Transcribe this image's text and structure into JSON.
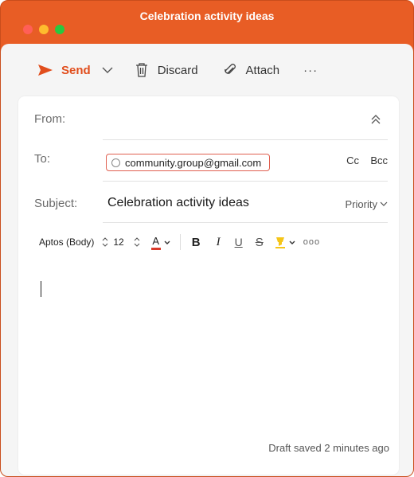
{
  "window": {
    "title": "Celebration activity ideas",
    "accent_color": "#e85d25"
  },
  "toolbar": {
    "send_label": "Send",
    "discard_label": "Discard",
    "attach_label": "Attach",
    "more_label": "···"
  },
  "fields": {
    "from_label": "From:",
    "to_label": "To:",
    "recipient": "community.group@gmail.com",
    "cc_label": "Cc",
    "bcc_label": "Bcc",
    "subject_label": "Subject:",
    "subject_value": "Celebration activity ideas",
    "priority_label": "Priority"
  },
  "formatting": {
    "font_name": "Aptos (Body)",
    "font_size": "12",
    "font_color_glyph": "A",
    "bold_glyph": "B",
    "italic_glyph": "I",
    "underline_glyph": "U",
    "strike_glyph": "S",
    "more_label": "ooo",
    "font_color": "#d93a2b",
    "highlight_color": "#f5c518"
  },
  "status": {
    "draft_text": "Draft saved 2 minutes ago"
  },
  "icons": {
    "send": "send-icon",
    "discard": "trash-icon",
    "attach": "paperclip-icon",
    "collapse": "double-chevron-up-icon"
  }
}
